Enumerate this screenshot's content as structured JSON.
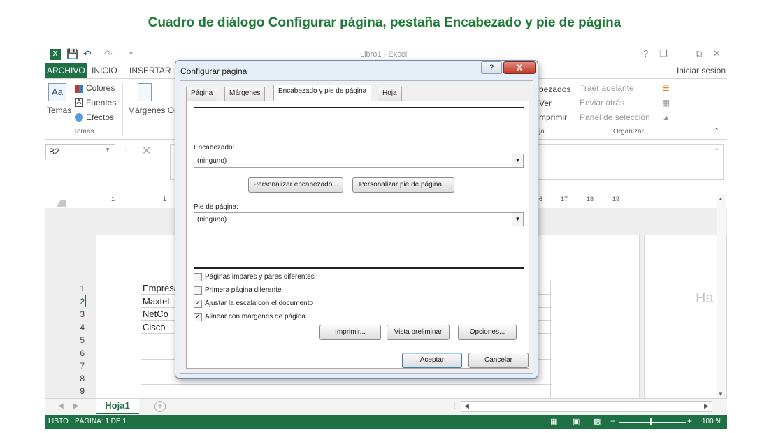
{
  "heading": "Cuadro de diálogo Configurar página, pestaña Encabezado y pie de página",
  "excel": {
    "doc_title": "Libro1 - Excel",
    "logo": "X",
    "tabs": [
      "ARCHIVO",
      "INICIO",
      "INSERTAR"
    ],
    "signin": "Iniciar sesión",
    "window_controls": [
      "?",
      "❐",
      "–",
      "⧉",
      "✕"
    ],
    "ribbon": {
      "temas": "Temas",
      "colores": "Colores",
      "fuentes": "Fuentes",
      "efectos": "Efectos",
      "margenes": "Márgenes Or",
      "temas_group": "Temas",
      "encabezados": "bezados",
      "ver": "Ver",
      "imprimir": "mprimir",
      "hoja_group_fragment": "ja",
      "traer": "Traer adelante",
      "enviar": "Enviar atrás",
      "panel": "Panel de selección",
      "organizar_group": "Organizar"
    },
    "namebox": "B2",
    "ruler_left": [
      "1",
      "1"
    ],
    "ruler_right": [
      "6",
      "17",
      "18",
      "19"
    ],
    "column_fragment": "A",
    "rows": [
      "1",
      "2",
      "3",
      "4",
      "5",
      "6",
      "7",
      "8",
      "9"
    ],
    "cells": [
      "Empresa",
      "Maxtel",
      "NetCo",
      "Cisco"
    ],
    "right_page_fragment": "Ha",
    "sheet_tab": "Hoja1",
    "status_left": [
      "LISTO",
      "PÁGINA: 1 DE 1"
    ],
    "zoom": "100 %"
  },
  "dialog": {
    "title": "Configurar página",
    "help_label": "?",
    "close_label": "X",
    "tabs": [
      "Página",
      "Márgenes",
      "Encabezado y pie de página",
      "Hoja"
    ],
    "active_tab": "Encabezado y pie de página",
    "header_label": "Encabezado:",
    "header_value": "(ninguno)",
    "customize_header": "Personalizar encabezado...",
    "customize_footer": "Personalizar pie de página...",
    "footer_label": "Pie de página:",
    "footer_value": "(ninguno)",
    "checkboxes": [
      {
        "label": "Páginas impares y pares diferentes",
        "checked": false
      },
      {
        "label": "Primera página diferente",
        "checked": false
      },
      {
        "label": "Ajustar la escala con el documento",
        "checked": true
      },
      {
        "label": "Alinear con márgenes de página",
        "checked": true
      }
    ],
    "print_button": "Imprimir...",
    "preview_button": "Vista preliminar",
    "options_button": "Opciones...",
    "ok_button": "Aceptar",
    "cancel_button": "Cancelar"
  },
  "colors": {
    "excel_green": "#1e7145",
    "heading_green": "#1e7a36",
    "dialog_frame": "#e6eff8"
  }
}
